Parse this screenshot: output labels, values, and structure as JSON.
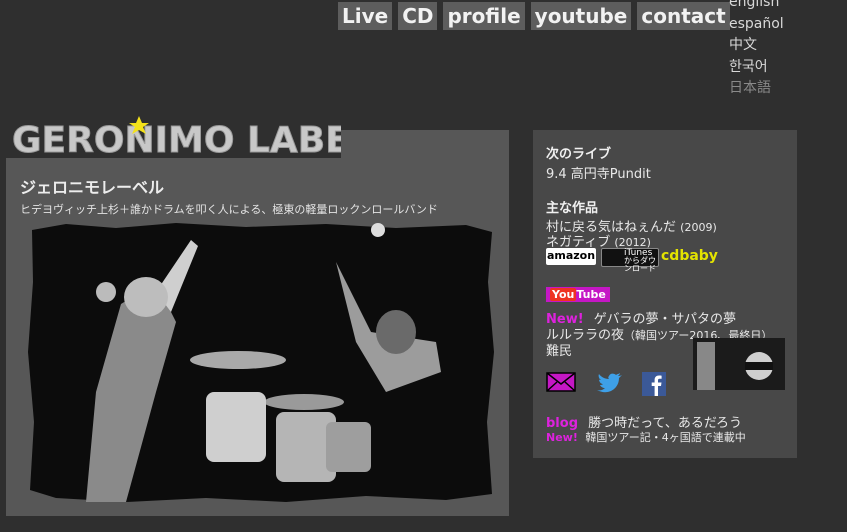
{
  "nav": {
    "items": [
      "Live",
      "CD",
      "profile",
      "youtube",
      "contact"
    ]
  },
  "languages": {
    "items": [
      "english",
      "español",
      "中文",
      "한국어",
      "日本語"
    ],
    "current_index": 4
  },
  "logo": {
    "text": "GERONIMO LABEL"
  },
  "main": {
    "title": "ジェロニモレーベル",
    "subtitle": "ヒデヨヴィッチ上杉＋誰かドラムを叩く人による、極東の軽量ロックンロールバンド"
  },
  "side": {
    "live_heading": "次のライブ",
    "live_text": "9.4 高円寺Pundit",
    "works_heading": "主な作品",
    "work1_title": "村に戻る気はねぇんだ",
    "work1_year": "(2009)",
    "work2_title": "ネガティブ",
    "work2_year": "(2012)",
    "store_amazon": "amazon",
    "store_itunes": "iTunes",
    "store_itunes_sub": "からダウンロード",
    "store_cdbaby": "cdbaby",
    "youtube_badge_a": "You",
    "youtube_badge_b": "Tube",
    "new_label": "New!",
    "video1": "ゲバラの夢・サパタの夢",
    "video2": "ルルララの夜",
    "video2_note": "（韓国ツアー2016、最終日）",
    "video3": "難民",
    "blog_label": "blog",
    "blog_title": "勝つ時だって、あるだろう",
    "blog_new": "New!",
    "blog_note": "韓国ツアー記・4ヶ国語で連載中"
  },
  "colors": {
    "accent": "#dd22dd",
    "twitter": "#3ea0e8",
    "facebook": "#3b5998",
    "cdbaby": "#e3e300"
  },
  "icons": [
    "mail-icon",
    "twitter-icon",
    "facebook-icon"
  ]
}
